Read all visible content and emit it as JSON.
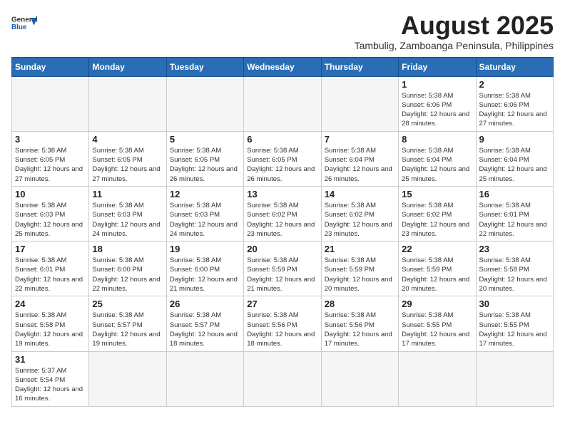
{
  "header": {
    "logo_general": "General",
    "logo_blue": "Blue",
    "title": "August 2025",
    "subtitle": "Tambulig, Zamboanga Peninsula, Philippines"
  },
  "days_of_week": [
    "Sunday",
    "Monday",
    "Tuesday",
    "Wednesday",
    "Thursday",
    "Friday",
    "Saturday"
  ],
  "weeks": [
    [
      {
        "day": "",
        "info": ""
      },
      {
        "day": "",
        "info": ""
      },
      {
        "day": "",
        "info": ""
      },
      {
        "day": "",
        "info": ""
      },
      {
        "day": "",
        "info": ""
      },
      {
        "day": "1",
        "info": "Sunrise: 5:38 AM\nSunset: 6:06 PM\nDaylight: 12 hours and 28 minutes."
      },
      {
        "day": "2",
        "info": "Sunrise: 5:38 AM\nSunset: 6:06 PM\nDaylight: 12 hours and 27 minutes."
      }
    ],
    [
      {
        "day": "3",
        "info": "Sunrise: 5:38 AM\nSunset: 6:05 PM\nDaylight: 12 hours and 27 minutes."
      },
      {
        "day": "4",
        "info": "Sunrise: 5:38 AM\nSunset: 6:05 PM\nDaylight: 12 hours and 27 minutes."
      },
      {
        "day": "5",
        "info": "Sunrise: 5:38 AM\nSunset: 6:05 PM\nDaylight: 12 hours and 26 minutes."
      },
      {
        "day": "6",
        "info": "Sunrise: 5:38 AM\nSunset: 6:05 PM\nDaylight: 12 hours and 26 minutes."
      },
      {
        "day": "7",
        "info": "Sunrise: 5:38 AM\nSunset: 6:04 PM\nDaylight: 12 hours and 26 minutes."
      },
      {
        "day": "8",
        "info": "Sunrise: 5:38 AM\nSunset: 6:04 PM\nDaylight: 12 hours and 25 minutes."
      },
      {
        "day": "9",
        "info": "Sunrise: 5:38 AM\nSunset: 6:04 PM\nDaylight: 12 hours and 25 minutes."
      }
    ],
    [
      {
        "day": "10",
        "info": "Sunrise: 5:38 AM\nSunset: 6:03 PM\nDaylight: 12 hours and 25 minutes."
      },
      {
        "day": "11",
        "info": "Sunrise: 5:38 AM\nSunset: 6:03 PM\nDaylight: 12 hours and 24 minutes."
      },
      {
        "day": "12",
        "info": "Sunrise: 5:38 AM\nSunset: 6:03 PM\nDaylight: 12 hours and 24 minutes."
      },
      {
        "day": "13",
        "info": "Sunrise: 5:38 AM\nSunset: 6:02 PM\nDaylight: 12 hours and 23 minutes."
      },
      {
        "day": "14",
        "info": "Sunrise: 5:38 AM\nSunset: 6:02 PM\nDaylight: 12 hours and 23 minutes."
      },
      {
        "day": "15",
        "info": "Sunrise: 5:38 AM\nSunset: 6:02 PM\nDaylight: 12 hours and 23 minutes."
      },
      {
        "day": "16",
        "info": "Sunrise: 5:38 AM\nSunset: 6:01 PM\nDaylight: 12 hours and 22 minutes."
      }
    ],
    [
      {
        "day": "17",
        "info": "Sunrise: 5:38 AM\nSunset: 6:01 PM\nDaylight: 12 hours and 22 minutes."
      },
      {
        "day": "18",
        "info": "Sunrise: 5:38 AM\nSunset: 6:00 PM\nDaylight: 12 hours and 22 minutes."
      },
      {
        "day": "19",
        "info": "Sunrise: 5:38 AM\nSunset: 6:00 PM\nDaylight: 12 hours and 21 minutes."
      },
      {
        "day": "20",
        "info": "Sunrise: 5:38 AM\nSunset: 5:59 PM\nDaylight: 12 hours and 21 minutes."
      },
      {
        "day": "21",
        "info": "Sunrise: 5:38 AM\nSunset: 5:59 PM\nDaylight: 12 hours and 20 minutes."
      },
      {
        "day": "22",
        "info": "Sunrise: 5:38 AM\nSunset: 5:59 PM\nDaylight: 12 hours and 20 minutes."
      },
      {
        "day": "23",
        "info": "Sunrise: 5:38 AM\nSunset: 5:58 PM\nDaylight: 12 hours and 20 minutes."
      }
    ],
    [
      {
        "day": "24",
        "info": "Sunrise: 5:38 AM\nSunset: 5:58 PM\nDaylight: 12 hours and 19 minutes."
      },
      {
        "day": "25",
        "info": "Sunrise: 5:38 AM\nSunset: 5:57 PM\nDaylight: 12 hours and 19 minutes."
      },
      {
        "day": "26",
        "info": "Sunrise: 5:38 AM\nSunset: 5:57 PM\nDaylight: 12 hours and 18 minutes."
      },
      {
        "day": "27",
        "info": "Sunrise: 5:38 AM\nSunset: 5:56 PM\nDaylight: 12 hours and 18 minutes."
      },
      {
        "day": "28",
        "info": "Sunrise: 5:38 AM\nSunset: 5:56 PM\nDaylight: 12 hours and 17 minutes."
      },
      {
        "day": "29",
        "info": "Sunrise: 5:38 AM\nSunset: 5:55 PM\nDaylight: 12 hours and 17 minutes."
      },
      {
        "day": "30",
        "info": "Sunrise: 5:38 AM\nSunset: 5:55 PM\nDaylight: 12 hours and 17 minutes."
      }
    ],
    [
      {
        "day": "31",
        "info": "Sunrise: 5:37 AM\nSunset: 5:54 PM\nDaylight: 12 hours and 16 minutes."
      },
      {
        "day": "",
        "info": ""
      },
      {
        "day": "",
        "info": ""
      },
      {
        "day": "",
        "info": ""
      },
      {
        "day": "",
        "info": ""
      },
      {
        "day": "",
        "info": ""
      },
      {
        "day": "",
        "info": ""
      }
    ]
  ]
}
